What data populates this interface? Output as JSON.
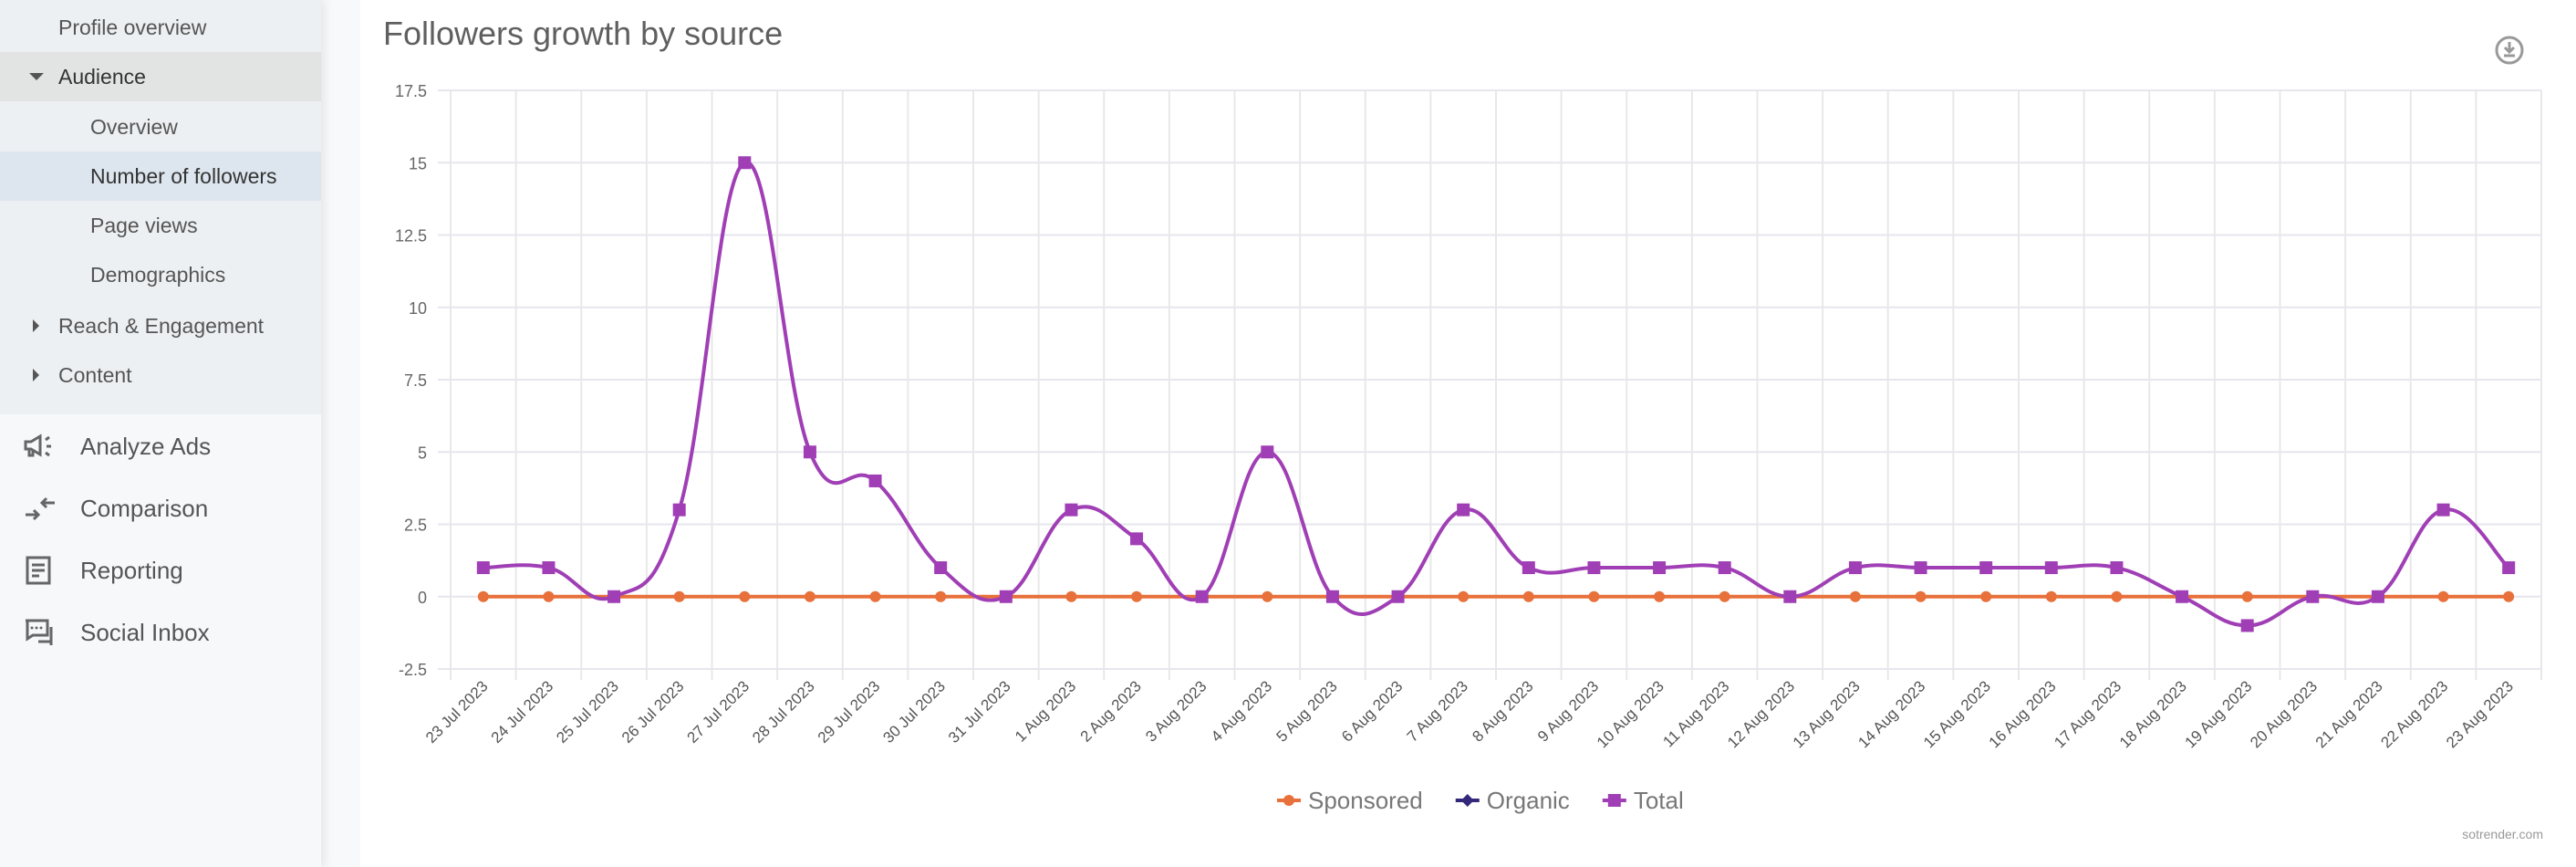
{
  "sidebar": {
    "profile_overview": "Profile overview",
    "audience": "Audience",
    "audience_items": [
      "Overview",
      "Number of followers",
      "Page views",
      "Demographics"
    ],
    "reach": "Reach & Engagement",
    "content": "Content",
    "main_items": [
      "Analyze Ads",
      "Comparison",
      "Reporting",
      "Social Inbox"
    ]
  },
  "credit": "sotrender.com",
  "chart_data": {
    "type": "line",
    "title": "Followers growth by source",
    "xlabel": "",
    "ylabel": "",
    "ylim": [
      -2.5,
      17.5
    ],
    "yticks": [
      "-2.5",
      "0",
      "2.5",
      "5",
      "7.5",
      "10",
      "12.5",
      "15",
      "17.5"
    ],
    "grid": true,
    "legend": "bottom-center",
    "categories": [
      "23 Jul 2023",
      "24 Jul 2023",
      "25 Jul 2023",
      "26 Jul 2023",
      "27 Jul 2023",
      "28 Jul 2023",
      "29 Jul 2023",
      "30 Jul 2023",
      "31 Jul 2023",
      "1 Aug 2023",
      "2 Aug 2023",
      "3 Aug 2023",
      "4 Aug 2023",
      "5 Aug 2023",
      "6 Aug 2023",
      "7 Aug 2023",
      "8 Aug 2023",
      "9 Aug 2023",
      "10 Aug 2023",
      "11 Aug 2023",
      "12 Aug 2023",
      "13 Aug 2023",
      "14 Aug 2023",
      "15 Aug 2023",
      "16 Aug 2023",
      "17 Aug 2023",
      "18 Aug 2023",
      "19 Aug 2023",
      "20 Aug 2023",
      "21 Aug 2023",
      "22 Aug 2023",
      "23 Aug 2023"
    ],
    "series": [
      {
        "name": "Sponsored",
        "color": "#e8703a",
        "marker": "circle",
        "values": [
          0,
          0,
          0,
          0,
          0,
          0,
          0,
          0,
          0,
          0,
          0,
          0,
          0,
          0,
          0,
          0,
          0,
          0,
          0,
          0,
          0,
          0,
          0,
          0,
          0,
          0,
          0,
          0,
          0,
          0,
          0,
          0
        ]
      },
      {
        "name": "Organic",
        "color": "#33287a",
        "marker": "diamond",
        "values": [
          1,
          1,
          0,
          3,
          15,
          5,
          4,
          1,
          0,
          3,
          2,
          0,
          5,
          0,
          0,
          3,
          1,
          1,
          1,
          1,
          0,
          1,
          1,
          1,
          1,
          1,
          0,
          -1,
          0,
          0,
          3,
          1
        ]
      },
      {
        "name": "Total",
        "color": "#a03fb5",
        "marker": "square",
        "values": [
          1,
          1,
          0,
          3,
          15,
          5,
          4,
          1,
          0,
          3,
          2,
          0,
          5,
          0,
          0,
          3,
          1,
          1,
          1,
          1,
          0,
          1,
          1,
          1,
          1,
          1,
          0,
          -1,
          0,
          0,
          3,
          1
        ]
      }
    ]
  }
}
